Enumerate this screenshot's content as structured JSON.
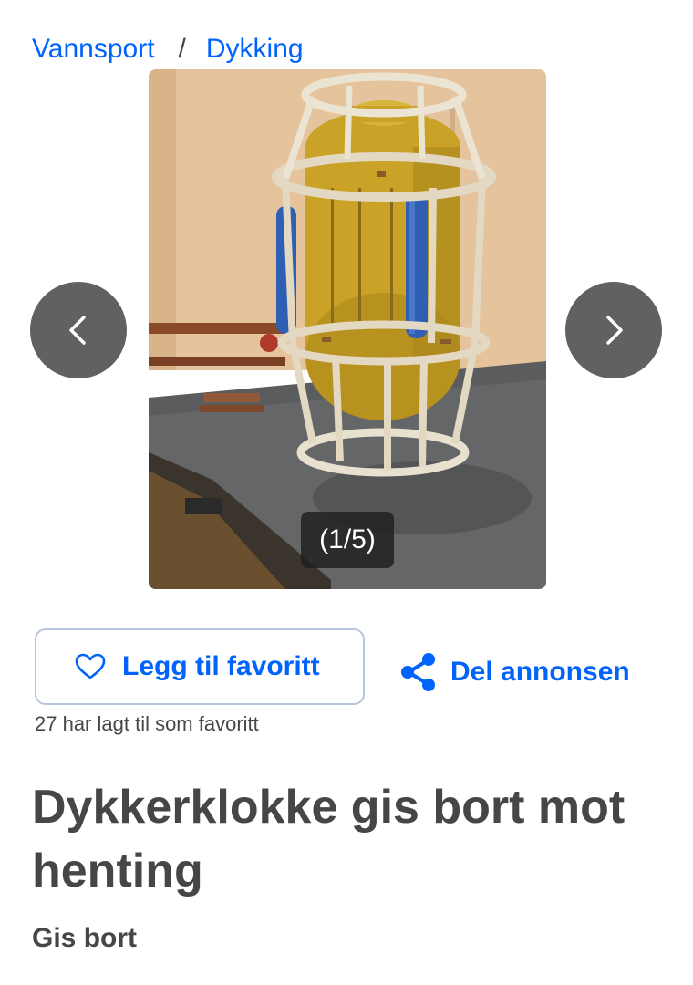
{
  "breadcrumb": {
    "items": [
      {
        "label": "Vannsport"
      },
      {
        "label": "Dykking"
      }
    ],
    "separator": "/"
  },
  "gallery": {
    "counter": "(1/5)",
    "image": "Yellow diving bell with blue gas cylinders inside a white protective cage, standing on a concrete floor in front of a beige wall",
    "prev_icon": "chevron-left-icon",
    "next_icon": "chevron-right-icon"
  },
  "actions": {
    "favorite_label": "Legg til favoritt",
    "favorite_icon": "heart-outline-icon",
    "share_label": "Del annonsen",
    "share_icon": "share-icon",
    "favorite_count_text": "27 har lagt til som favoritt"
  },
  "listing": {
    "title": "Dykkerklokke gis bort mot henting",
    "price_text": "Gis bort"
  },
  "colors": {
    "accent": "#0063fb",
    "text": "#464646",
    "nav_button": "#616161"
  }
}
